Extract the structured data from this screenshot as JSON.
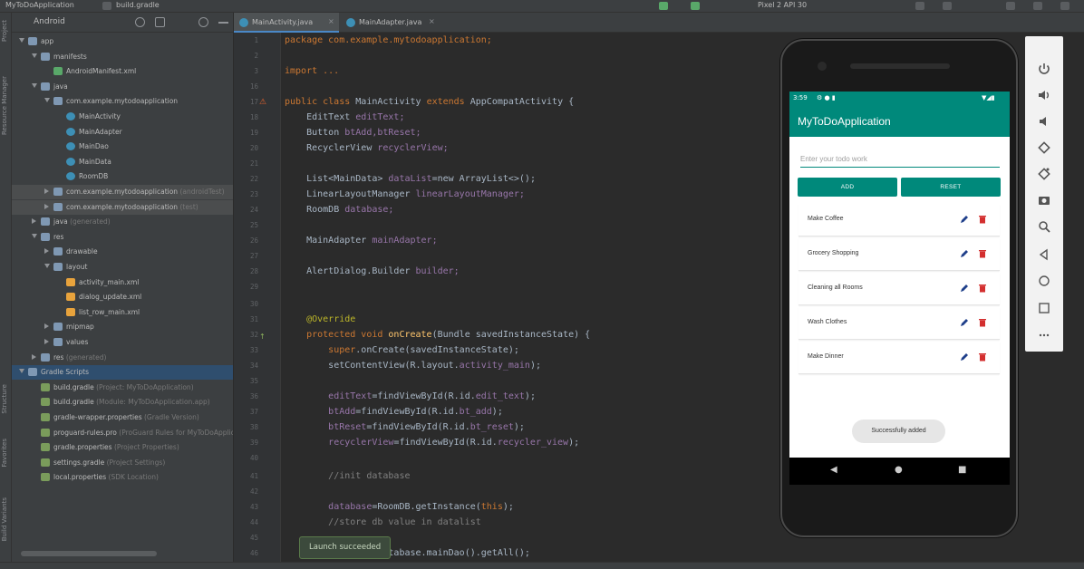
{
  "window": {
    "breadcrumb_project": "MyToDoApplication",
    "breadcrumb_file": "build.gradle",
    "device": "Pixel 2 API 30"
  },
  "project_panel": {
    "view_mode": "Android",
    "tree": [
      {
        "label": "app",
        "extra": ""
      },
      {
        "label": "manifests",
        "extra": ""
      },
      {
        "label": "AndroidManifest.xml",
        "extra": ""
      },
      {
        "label": "java",
        "extra": ""
      },
      {
        "label": "com.example.mytodoapplication",
        "extra": ""
      },
      {
        "label": "MainActivity",
        "extra": ""
      },
      {
        "label": "MainAdapter",
        "extra": ""
      },
      {
        "label": "MainDao",
        "extra": ""
      },
      {
        "label": "MainData",
        "extra": ""
      },
      {
        "label": "RoomDB",
        "extra": ""
      },
      {
        "label": "com.example.mytodoapplication",
        "extra": "(androidTest)"
      },
      {
        "label": "com.example.mytodoapplication",
        "extra": "(test)"
      },
      {
        "label": "java",
        "extra": "(generated)"
      },
      {
        "label": "res",
        "extra": ""
      },
      {
        "label": "drawable",
        "extra": ""
      },
      {
        "label": "layout",
        "extra": ""
      },
      {
        "label": "activity_main.xml",
        "extra": ""
      },
      {
        "label": "dialog_update.xml",
        "extra": ""
      },
      {
        "label": "list_row_main.xml",
        "extra": ""
      },
      {
        "label": "mipmap",
        "extra": ""
      },
      {
        "label": "values",
        "extra": ""
      },
      {
        "label": "res",
        "extra": "(generated)"
      },
      {
        "label": "Gradle Scripts",
        "extra": ""
      },
      {
        "label": "build.gradle",
        "extra": "(Project: MyToDoApplication)"
      },
      {
        "label": "build.gradle",
        "extra": "(Module: MyToDoApplication.app)"
      },
      {
        "label": "gradle-wrapper.properties",
        "extra": "(Gradle Version)"
      },
      {
        "label": "proguard-rules.pro",
        "extra": "(ProGuard Rules for MyToDoApplication)"
      },
      {
        "label": "gradle.properties",
        "extra": "(Project Properties)"
      },
      {
        "label": "settings.gradle",
        "extra": "(Project Settings)"
      },
      {
        "label": "local.properties",
        "extra": "(SDK Location)"
      }
    ]
  },
  "left_tool_strip": {
    "project": "Project",
    "resource_manager": "Resource Manager",
    "structure": "Structure",
    "favorites": "Favorites",
    "build_variants": "Build Variants"
  },
  "editor": {
    "tabs": [
      "MainActivity.java",
      "MainAdapter.java"
    ],
    "line_numbers": [
      "1",
      "2",
      "3",
      "16",
      "17",
      "18",
      "19",
      "20",
      "21",
      "22",
      "23",
      "24",
      "25",
      "26",
      "27",
      "28",
      "29",
      "30",
      "31",
      "32",
      "33",
      "34",
      "35",
      "36",
      "37",
      "38",
      "39",
      "40",
      "41",
      "42",
      "43",
      "44",
      "45",
      "46"
    ],
    "code": {
      "l1": "package com.example.mytodoapplication;",
      "l2": "import ...",
      "l3a": "public class ",
      "l3b": "MainActivity ",
      "l3c": "extends ",
      "l3d": "AppCompatActivity {",
      "l4a": "EditText ",
      "l4b": "editText;",
      "l5a": "Button ",
      "l5b": "btAdd,btReset;",
      "l6a": "RecyclerView ",
      "l6b": "recyclerView;",
      "l7a": "List<MainData> ",
      "l7b": "dataList",
      "l7c": "=new ArrayList<>();",
      "l8a": "LinearLayoutManager ",
      "l8b": "linearLayoutManager;",
      "l9a": "RoomDB ",
      "l9b": "database;",
      "l10a": "MainAdapter ",
      "l10b": "mainAdapter;",
      "l11a": "AlertDialog.Builder ",
      "l11b": "builder;",
      "l12": "@Override",
      "l13a": "protected void ",
      "l13b": "onCreate",
      "l13c": "(Bundle savedInstanceState) {",
      "l14a": "super",
      "l14b": ".onCreate(savedInstanceState);",
      "l15a": "setContentView(R.layout.",
      "l15b": "activity_main",
      "l15c": ");",
      "l16a": "editText",
      "l16b": "=findViewById(R.id.",
      "l16c": "edit_text",
      "l16d": ");",
      "l17a": "btAdd",
      "l17b": "=findViewById(R.id.",
      "l17c": "bt_add",
      "l17d": ");",
      "l18a": "btReset",
      "l18b": "=findViewById(R.id.",
      "l18c": "bt_reset",
      "l18d": ");",
      "l19a": "recyclerView",
      "l19b": "=findViewById(R.id.",
      "l19c": "recycler_view",
      "l19d": ");",
      "l20": "//init database",
      "l21a": "database",
      "l21b": "=RoomDB.getInstance(",
      "l21c": "this",
      "l21d": ");",
      "l22": "//store db value in datalist",
      "l23a": "dataList",
      "l23b": "=database.mainDao().getAll();"
    }
  },
  "launch_toast": "Launch succeeded",
  "emulator": {
    "time": "3:59",
    "app_title": "MyToDoApplication",
    "input_placeholder": "Enter your todo work",
    "add_label": "ADD",
    "reset_label": "RESET",
    "todos": [
      "Make Coffee",
      "Grocery Shopping",
      "Cleaning all Rooms",
      "Wash Clothes",
      "Make Dinner"
    ],
    "toast": "Successfully added",
    "nav_back": "◀",
    "nav_home": "●",
    "nav_recents": "■",
    "accent_color": "#00897b"
  }
}
